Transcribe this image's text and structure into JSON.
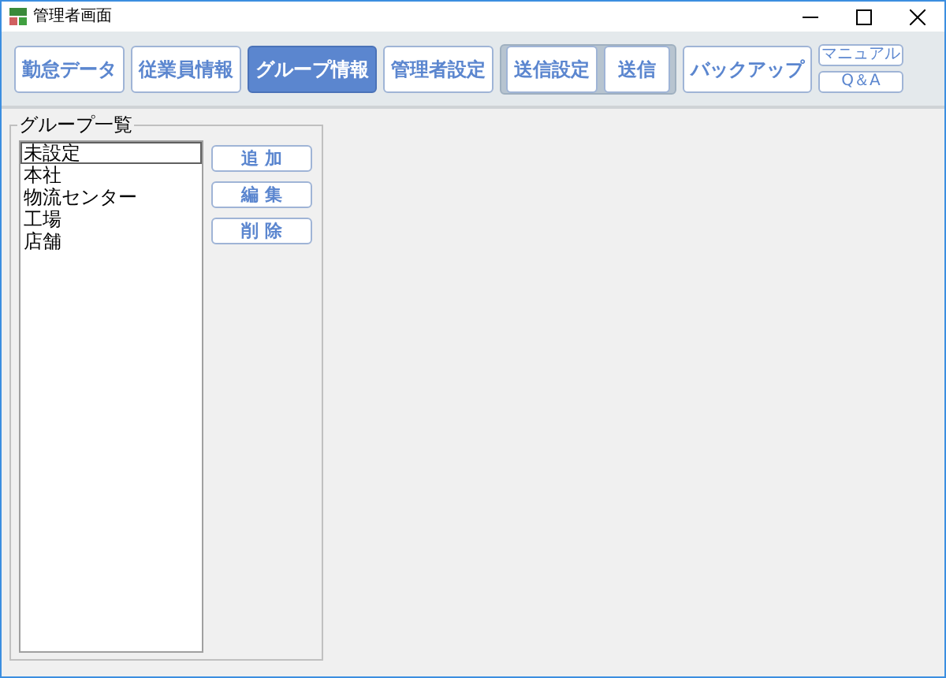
{
  "window": {
    "title": "管理者画面"
  },
  "tabs": [
    {
      "kind": "tab",
      "label": "勤怠データ",
      "selected": false
    },
    {
      "kind": "tab",
      "label": "従業員情報",
      "selected": false
    },
    {
      "kind": "tab",
      "label": "グループ情報",
      "selected": true
    },
    {
      "kind": "tab",
      "label": "管理者設定",
      "selected": false
    },
    {
      "kind": "group",
      "items": [
        {
          "label": "送信設定",
          "selected": false
        },
        {
          "label": "送信",
          "selected": false
        }
      ]
    },
    {
      "kind": "tab",
      "label": "バックアップ",
      "selected": false
    }
  ],
  "help_buttons": [
    "マニュアル",
    "Q＆A"
  ],
  "group_list": {
    "title": "グループ一覧",
    "items": [
      {
        "label": "未設定",
        "focused": true
      },
      {
        "label": "本社",
        "focused": false
      },
      {
        "label": "物流センター",
        "focused": false
      },
      {
        "label": "工場",
        "focused": false
      },
      {
        "label": "店舗",
        "focused": false
      }
    ],
    "buttons": [
      "追 加",
      "編 集",
      "削 除"
    ]
  }
}
